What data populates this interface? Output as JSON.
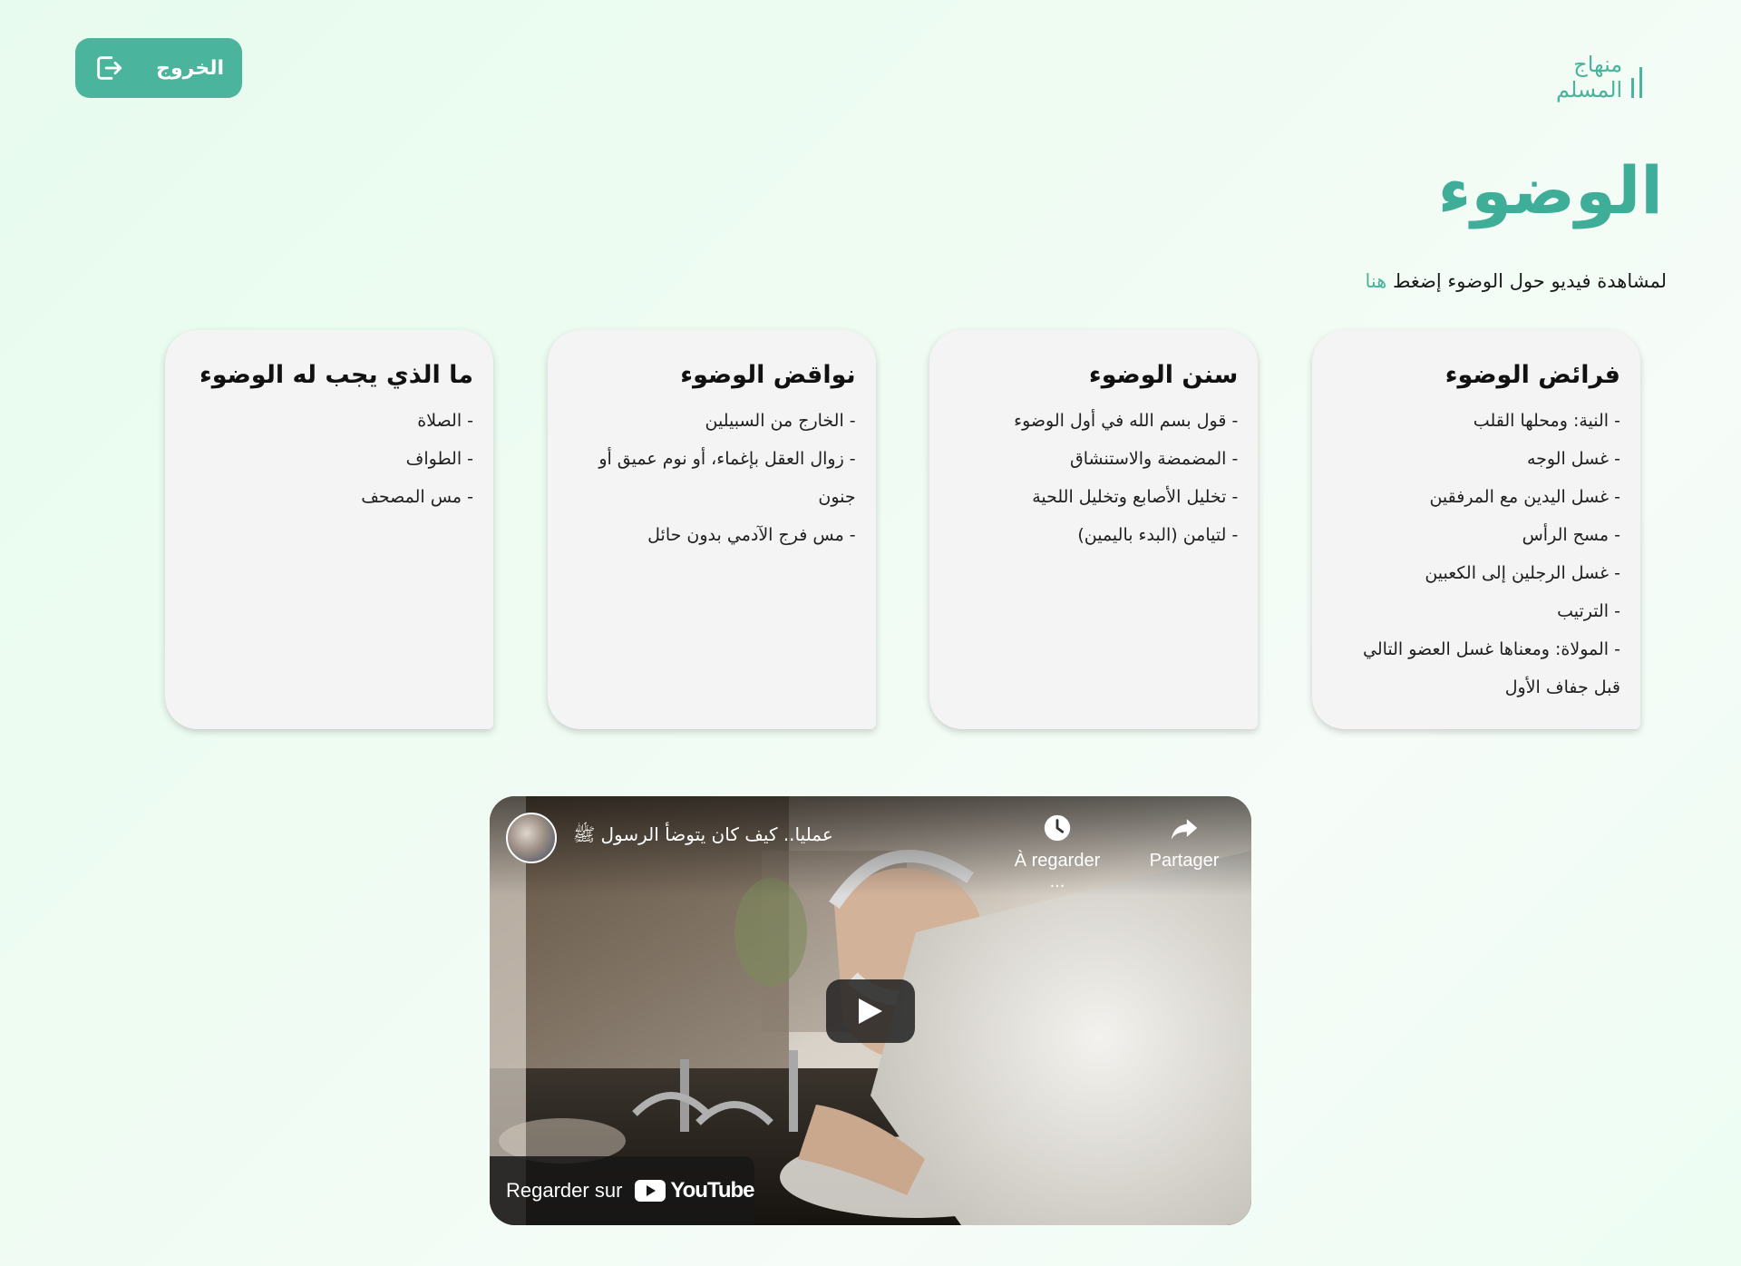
{
  "header": {
    "logout_label": "الخروج",
    "logo_text_line1": "منهاج",
    "logo_text_line2": "المسلم"
  },
  "page": {
    "title": "الوضوء",
    "intro_text": "لمشاهدة فيديو حول الوضوء إضغط ",
    "intro_link": "هنا"
  },
  "cards": [
    {
      "title": "فرائض الوضوء",
      "items": [
        "- النية: ومحلها القلب",
        "- غسل الوجه",
        "- غسل اليدين مع المرفقين",
        "- مسح الرأس",
        "- غسل الرجلين إلى الكعبين",
        "- الترتيب",
        "- المولاة: ومعناها غسل العضو التالي قبل جفاف الأول"
      ]
    },
    {
      "title": "سنن الوضوء",
      "items": [
        "- قول بسم الله في أول الوضوء",
        "- المضمضة والاستنشاق",
        "- تخليل الأصابع وتخليل اللحية",
        "- لتيامن (البدء باليمين)"
      ]
    },
    {
      "title": "نواقض الوضوء",
      "items": [
        "- الخارج من السبيلين",
        "- زوال العقل بإغماء، أو نوم عميق أو جنون",
        "- مس فرج الآدمي بدون حائل"
      ]
    },
    {
      "title": "ما الذي يجب له الوضوء",
      "items": [
        "- الصلاة",
        "- الطواف",
        "- مس المصحف"
      ]
    }
  ],
  "video": {
    "title": "عمليا.. كيف كان يتوضأ الرسول ﷺ",
    "watch_later_label": "À regarder ...",
    "share_label": "Partager",
    "watch_on_label": "Regarder sur",
    "youtube_wordmark": "YouTube"
  },
  "colors": {
    "accent": "#4ab49c",
    "title": "#3fae98",
    "card_bg": "#f4f4f4"
  }
}
